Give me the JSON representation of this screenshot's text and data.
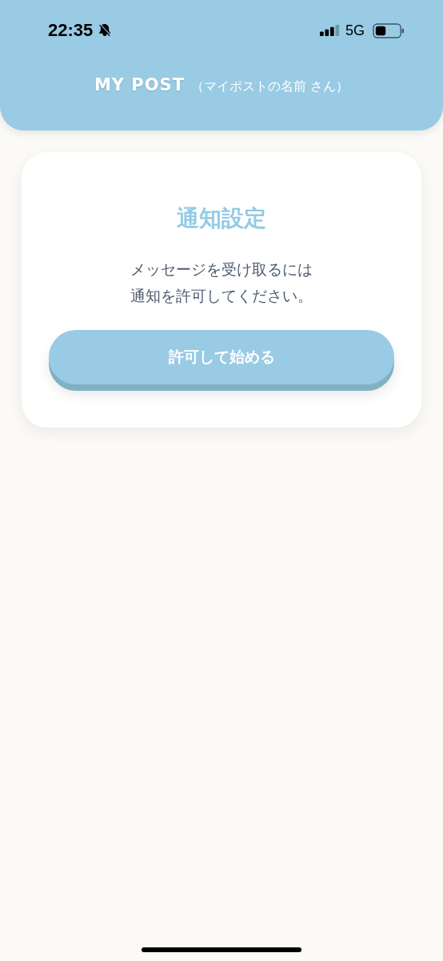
{
  "status_bar": {
    "time": "22:35",
    "network": "5G",
    "silent": true
  },
  "header": {
    "title": "MY POST",
    "subtitle": "（マイポストの名前 さん）"
  },
  "card": {
    "title": "通知設定",
    "message_lines": [
      "メッセージを受け取るには",
      "通知を許可してください。"
    ],
    "button": "許可して始める"
  }
}
